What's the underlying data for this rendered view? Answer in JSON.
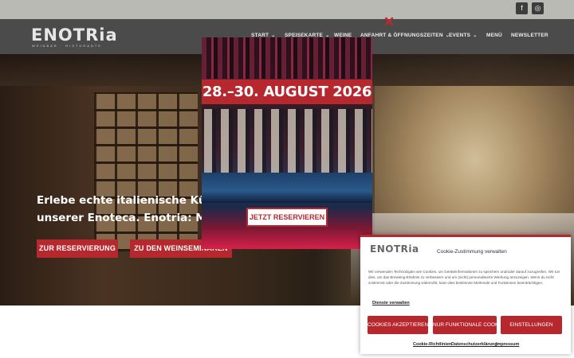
{
  "social": {
    "facebook_icon": "facebook-icon",
    "instagram_icon": "instagram-icon",
    "facebook_glyph": "f",
    "instagram_glyph": "◎"
  },
  "header": {
    "logo": "ENOTRia",
    "logo_sub": "WEINBAR · RISTORANTE",
    "nav": {
      "start": "START",
      "speisekarte": "SPEISEKARTE",
      "weine": "WEINE",
      "anfahrt": "ANFAHRT & ÖFFNUNGSZEITEN",
      "events": "EVENTS",
      "menu": "MENÜ",
      "newsletter": "NEWSLETTER"
    },
    "chevron_glyph": "⌄"
  },
  "hero": {
    "line1": "Erlebe echte italienische Küche und",
    "line2": "unserer Enoteca. Enotria: Mehr",
    "reservation_button": "ZUR RESERVIERUNG",
    "seminar_button": "ZU DEN WEINSEMINAREN"
  },
  "popup": {
    "date_banner": "28.–30. AUGUST 2026",
    "cta_button": "JETZT RESERVIEREN",
    "close_glyph": "✕"
  },
  "cookie": {
    "logo": "ENOTRia",
    "title": "Cookie-Zustimmung verwalten",
    "text": "Wir verwenden Technologien wie Cookies, um Geräteinformationen zu speichern und/oder darauf zuzugreifen. Wir tun dies, um das Browsing-Erlebnis zu verbessern und um (nicht) personalisierte Werbung anzuzeigen. Wenn du nicht zustimmst oder die Zustimmung widerrufst, kann dies bestimmte Merkmale und Funktionen beeinträchtigen.",
    "manage_link": "Dienste verwalten",
    "accept_button": "COOKIES AKZEPTIEREN",
    "functional_button": "NUR FUNKTIONALE COOKIES",
    "settings_button": "EINSTELLUNGEN",
    "links": {
      "cookie_policy": "Cookie-Richtlinien",
      "privacy": "Datenschutzerklärung",
      "imprint": "Impressum"
    }
  },
  "colors": {
    "brand_red": "#b7282e",
    "header_gray": "#4b4b4b",
    "topbar_gray": "#b9bab3"
  }
}
